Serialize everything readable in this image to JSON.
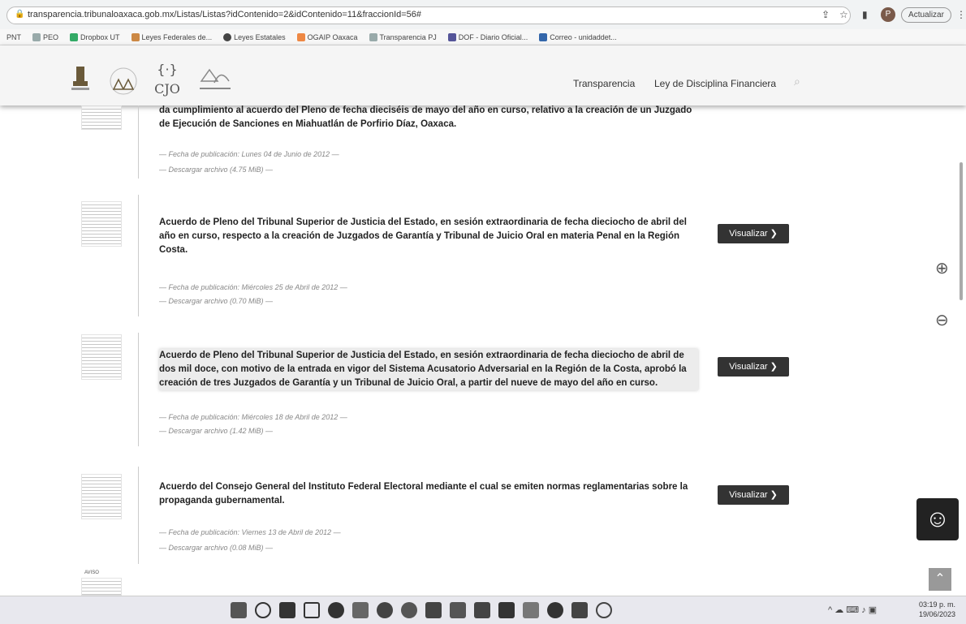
{
  "browser": {
    "url": "transparencia.tribunaloaxaca.gob.mx/Listas/Listas?idContenido=2&idContenido=11&fraccionId=56#",
    "update_label": "Actualizar",
    "profile_initial": "P"
  },
  "bookmarks": [
    "PNT",
    "PEO",
    "Dropbox UT",
    "Leyes Federales de...",
    "Leyes Estatales",
    "OGAIP Oaxaca",
    "Transparencia PJ",
    "DOF - Diario Oficial...",
    "Correo - unidaddet..."
  ],
  "site": {
    "logo_cjo": "CJO",
    "nav": [
      "Transparencia",
      "Ley de Disciplina Financiera"
    ]
  },
  "items": [
    {
      "desc": "da cumplimiento al acuerdo del Pleno de fecha dieciséis de mayo del año en curso, relativo a la creación de un Juzgado de Ejecución de Sanciones en Miahuatlán de Porfirio Díaz, Oaxaca.",
      "fecha": "— Fecha de publicación: Lunes 04 de Junio de 2012 —",
      "descarga": "— Descargar archivo (4.75 MiB) —"
    },
    {
      "desc": "Acuerdo de Pleno del Tribunal Superior de Justicia del Estado, en sesión extraordinaria de fecha dieciocho de abril del año en curso, respecto a la creación de Juzgados de Garantía y Tribunal de Juicio Oral en materia Penal en la Región Costa.",
      "fecha": "— Fecha de publicación: Miércoles 25 de Abril de 2012 —",
      "descarga": "— Descargar archivo (0.70 MiB) —"
    },
    {
      "desc": "Acuerdo de Pleno del Tribunal Superior de Justicia del Estado, en sesión extraordinaria de fecha dieciocho de abril de dos mil doce, con motivo de la entrada en vigor del Sistema Acusatorio Adversarial en la Región de la Costa, aprobó la creación de tres Juzgados de Garantía y un Tribunal de Juicio Oral, a partir del nueve de mayo del año en curso.",
      "fecha": "— Fecha de publicación: Miércoles 18 de Abril de 2012 —",
      "descarga": "— Descargar archivo (1.42 MiB) —"
    },
    {
      "desc": "Acuerdo del Consejo General del Instituto Federal Electoral mediante el cual se emiten normas reglamentarias sobre la propaganda gubernamental.",
      "fecha": "— Fecha de publicación: Viernes 13 de Abril de 2012 —",
      "descarga": "— Descargar archivo (0.08 MiB) —"
    }
  ],
  "visualizar_label": "Visualizar ❯",
  "thumb_last_label": "AVISO",
  "taskbar": {
    "time": "03:19 p. m.",
    "date": "19/06/2023"
  }
}
